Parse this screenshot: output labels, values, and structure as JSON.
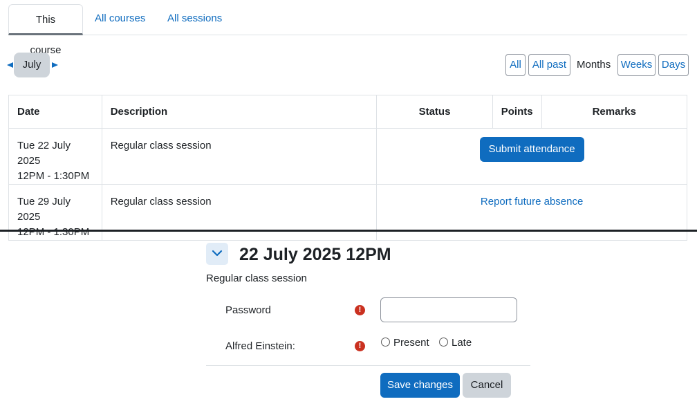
{
  "tabs": [
    "This course",
    "All courses",
    "All sessions"
  ],
  "month_nav": {
    "label": "July"
  },
  "views": {
    "all": "All",
    "all_past": "All past",
    "months": "Months",
    "weeks": "Weeks",
    "days": "Days"
  },
  "table": {
    "headers": [
      "Date",
      "Description",
      "Status",
      "Points",
      "Remarks"
    ],
    "rows": [
      {
        "date": "Tue 22 July 2025",
        "time": "12PM - 1:30PM",
        "description": "Regular class session",
        "action": "Submit attendance"
      },
      {
        "date": "Tue 29 July 2025",
        "time": "12PM - 1:30PM",
        "description": "Regular class session",
        "action": "Report future absence"
      }
    ]
  },
  "form": {
    "title": "22 July 2025 12PM",
    "description": "Regular class session",
    "password_label": "Password",
    "password_value": "",
    "student_label": "Alfred Einstein:",
    "options": [
      "Present",
      "Late"
    ],
    "required_icon": "!",
    "save_label": "Save changes",
    "cancel_label": "Cancel"
  },
  "colors": {
    "accent": "#0f6cbf",
    "required": "#ca3120",
    "secondary": "#ced4da"
  },
  "icons": {
    "collapse": "chevron-down-icon",
    "prev": "prev-arrow-icon",
    "next": "next-arrow-icon",
    "required": "required-icon"
  }
}
